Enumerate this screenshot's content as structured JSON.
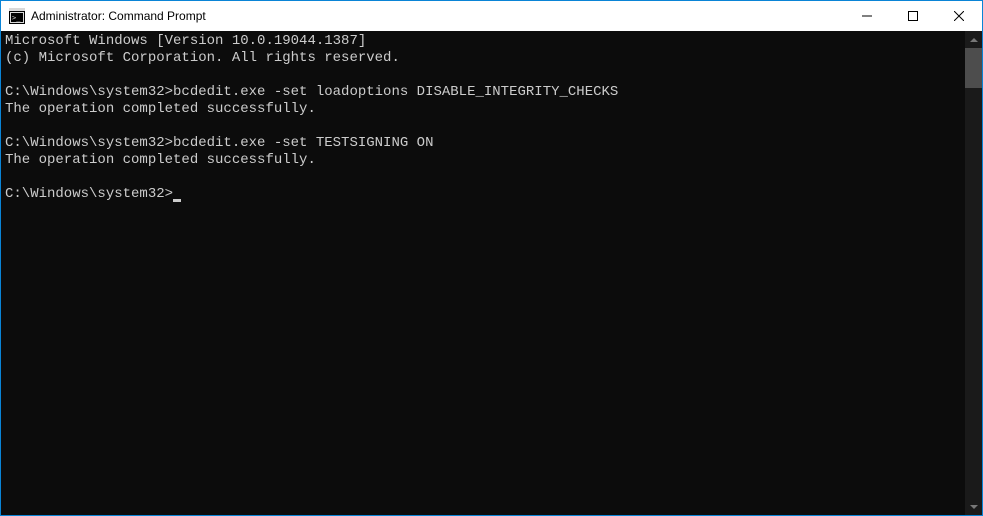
{
  "window": {
    "title": "Administrator: Command Prompt"
  },
  "terminal": {
    "lines": [
      "Microsoft Windows [Version 10.0.19044.1387]",
      "(c) Microsoft Corporation. All rights reserved.",
      "",
      "C:\\Windows\\system32>bcdedit.exe -set loadoptions DISABLE_INTEGRITY_CHECKS",
      "The operation completed successfully.",
      "",
      "C:\\Windows\\system32>bcdedit.exe -set TESTSIGNING ON",
      "The operation completed successfully.",
      ""
    ],
    "prompt": "C:\\Windows\\system32>"
  },
  "colors": {
    "border": "#0a84d6",
    "terminal_bg": "#0c0c0c",
    "terminal_fg": "#cccccc"
  }
}
